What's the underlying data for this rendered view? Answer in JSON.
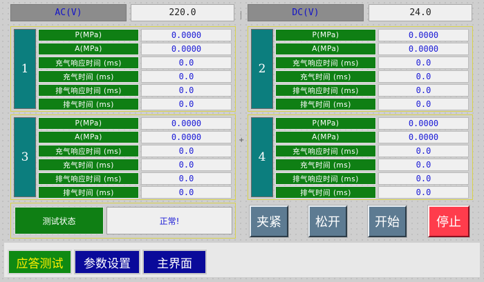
{
  "header": {
    "ac_label": "AC(V)",
    "ac_value": "220.0",
    "dc_label": "DC(V)",
    "dc_value": "24.0"
  },
  "channels": [
    {
      "number": "1",
      "rows": [
        {
          "label": "P(MPa)",
          "value": "0.0000"
        },
        {
          "label": "A(MPa)",
          "value": "0.0000"
        },
        {
          "label": "充气响应时间 (ms)",
          "value": "0.0"
        },
        {
          "label": "充气时间 (ms)",
          "value": "0.0"
        },
        {
          "label": "排气响应时间 (ms)",
          "value": "0.0"
        },
        {
          "label": "排气时间 (ms)",
          "value": "0.0"
        }
      ]
    },
    {
      "number": "2",
      "rows": [
        {
          "label": "P(MPa)",
          "value": "0.0000"
        },
        {
          "label": "A(MPa)",
          "value": "0.0000"
        },
        {
          "label": "充气响应时间 (ms)",
          "value": "0.0"
        },
        {
          "label": "充气时间 (ms)",
          "value": "0.0"
        },
        {
          "label": "排气响应时间 (ms)",
          "value": "0.0"
        },
        {
          "label": "排气时间 (ms)",
          "value": "0.0"
        }
      ]
    },
    {
      "number": "3",
      "rows": [
        {
          "label": "P(MPa)",
          "value": "0.0000"
        },
        {
          "label": "A(MPa)",
          "value": "0.0000"
        },
        {
          "label": "充气响应时间 (ms)",
          "value": "0.0"
        },
        {
          "label": "充气时间 (ms)",
          "value": "0.0"
        },
        {
          "label": "排气响应时间 (ms)",
          "value": "0.0"
        },
        {
          "label": "排气时间 (ms)",
          "value": "0.0"
        }
      ]
    },
    {
      "number": "4",
      "rows": [
        {
          "label": "P(MPa)",
          "value": "0.0000"
        },
        {
          "label": "A(MPa)",
          "value": "0.0000"
        },
        {
          "label": "充气响应时间 (ms)",
          "value": "0.0"
        },
        {
          "label": "充气时间 (ms)",
          "value": "0.0"
        },
        {
          "label": "排气响应时间 (ms)",
          "value": "0.0"
        },
        {
          "label": "排气时间 (ms)",
          "value": "0.0"
        }
      ]
    }
  ],
  "status": {
    "label": "测试状态",
    "value": "正常!"
  },
  "actions": {
    "clamp": "夹紧",
    "release": "松开",
    "start": "开始",
    "stop": "停止"
  },
  "nav": {
    "response_test": "应答测试",
    "param_settings": "参数设置",
    "main_screen": "主界面"
  },
  "colors": {
    "label_green": "#0f7f14",
    "value_blue": "#1a1ad6",
    "channel_teal": "#0c7e7e",
    "panel_border": "#d8d24c",
    "stop_red": "#ff3c4c",
    "nav_active_text": "#ffee00",
    "nav_inactive_bg": "#0a0a9a"
  }
}
